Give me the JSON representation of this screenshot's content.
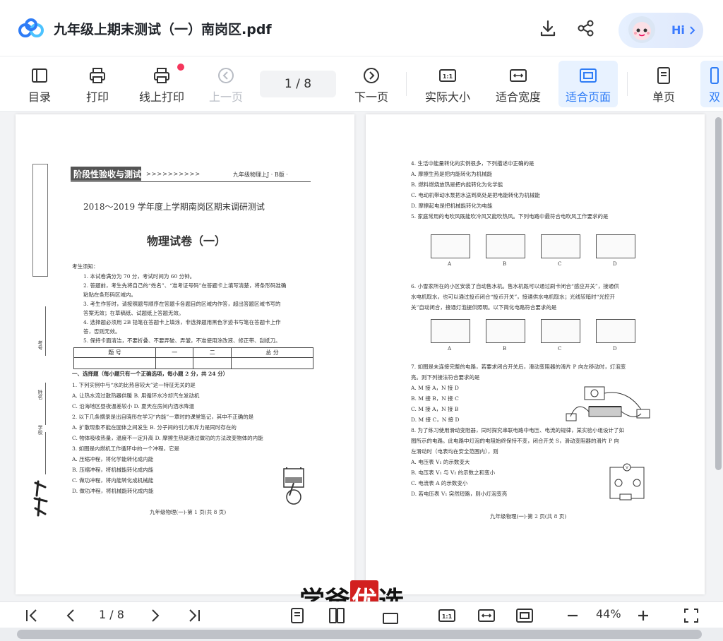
{
  "title": "九年级上期末测试（一）南岗区.pdf",
  "hi_label": "Hi",
  "toolbar": {
    "toc": "目录",
    "print": "打印",
    "online_print": "线上打印",
    "prev": "上一页",
    "page_indicator": "1  / 8",
    "next": "下一页",
    "actual_size": "实际大小",
    "fit_width": "适合宽度",
    "fit_page": "适合页面",
    "single": "单页",
    "double": "双"
  },
  "page1": {
    "banner": "阶段性验收与测试",
    "banner_right": "九年级物理上J · B版 ·",
    "exam_title": "2018～2019 学年度上学期南岗区期末调研测试",
    "paper_title": "物理试卷（一）",
    "notice_head": "考生须知：",
    "notices": [
      "1. 本试卷满分为 70 分，考试时间为 60 分钟。",
      "2. 答题前，考生先将自己的“姓名”、“准考证号码”在答题卡上填写清楚，将条形码准确",
      "   粘贴在条形码区域内。",
      "3. 考生作答时，请按照题号顺序在答题卡各题目的区域内作答，超出答题区域书写的",
      "   答案无效；在草稿纸、试题纸上答题无效。",
      "4. 选择题必须用 2B 铅笔在答题卡上填涂，非选择题用黑色字迹书写笔在答题卡上作",
      "   答，否则无效。",
      "5. 保持卡面清洁，不要折叠、不要弄破、弄皱，不准使用涂改液、修正带、刮纸刀。"
    ],
    "table_headers": [
      "题    号",
      "一",
      "二",
      "总    分"
    ],
    "section": "一、选择题（每小题只有一个正确选项，每小题 2 分，共 24 分）",
    "questions": [
      "1. 下列实例中与“水的比热容较大”这一特征无关的是",
      "A. 让热水流过散热器供暖            B. 用循环水冷却汽车发动机",
      "C. 沿海地区昼夜温差较小            D. 夏天在房间内洒水降温",
      "2. 以下几条摘录是出自晓彤在学习“内能”一章时的课堂笔记，其中不正确的是",
      "A. 扩散现象不能在固体之间发生        B. 分子间的引力和斥力是同时存在的",
      "C. 物体吸收热量，温度不一定升高      D. 摩擦生热是通过做功的方法改变物体的内能",
      "3. 如图是内燃机工作循环中的一个冲程，它是",
      "A. 压缩冲程，将化学能转化成内能",
      "B. 压缩冲程，将机械能转化成内能",
      "C. 做功冲程，将内能转化成机械能",
      "D. 做功冲程，将机械能转化成内能"
    ],
    "footer": "九年级物理(一)·第 1 页(共 8 页)",
    "side_labels": [
      "考号",
      "姓名",
      "学校"
    ]
  },
  "page2": {
    "lines": [
      "4. 生活中能量转化的实例很多，下列描述中正确的是",
      "A. 摩擦生热是把内能转化为机械能",
      "B. 燃料燃烧放热是把内能转化为化学能",
      "C. 电动机带动水泵把水送到高处是把电能转化为机械能",
      "D. 摩擦起电是把机械能转化为电能",
      "5. 家庭常用的电吹风既能吹冷风又能吹热风。下列电路中最符合电吹风工作要求的是"
    ],
    "q6": [
      "6. 小雪家所在的小区安装了自动售水机。售水机既可以通过刷卡闭合“感应开关”，接通供",
      "水电机取水，也可以通过投币闭合“投币开关”，接通供水电机取水；光线较暗时“光控开",
      "关”自动闭合，接通灯泡提供照明。以下简化电路符合要求的是"
    ],
    "q7": [
      "7. 如图是未连接完整的电路，若要求闭合开关后，滑动变阻器的滑片 P 向左移动时，灯泡变",
      "亮。则下列接法符合要求的是",
      "A. M 接 A，N 接 D",
      "B. M 接 B，N 接 C",
      "C. M 接 A，N 接 B",
      "D. M 接 C，N 接 D"
    ],
    "q8": [
      "8. 为了练习使用滑动变阻器，同时探究串联电路中电压、电流的规律，某实验小组设计了如",
      "图所示的电路。此电路中灯泡的电阻始终保持不变，闭合开关 S，滑动变阻器的滑片 P 向",
      "左滑动时（电表均在安全范围内），则",
      "A. 电压表 V₁ 的示数变大",
      "B. 电压表 V₁ 与 V₂ 的示数之和变小",
      "C. 电流表 A 的示数变小",
      "D. 若电压表 V₁ 突然短路，则小灯泡变亮"
    ],
    "choice_labels": [
      "A",
      "B",
      "C",
      "D"
    ],
    "footer": "九年级物理(一)·第 2 页(共 8 页)"
  },
  "bottom": {
    "page_indicator": "1  / 8",
    "zoom": "44%"
  },
  "watermark": {
    "part1": "学爸",
    "part2": "优",
    "part3": "选"
  },
  "colors": {
    "accent": "#2e7cf6",
    "active_bg": "#e8f2ff",
    "dot": "#f5365c"
  }
}
